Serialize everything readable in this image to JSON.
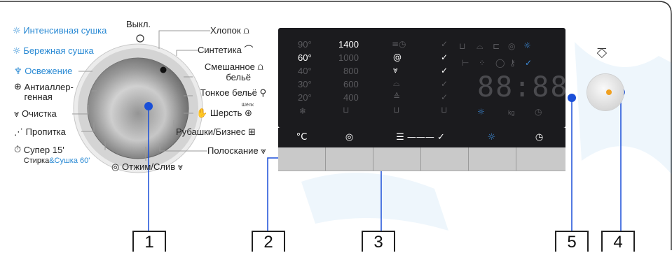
{
  "dial": {
    "off_label": "Выкл.",
    "left_programs": [
      {
        "label": "Интенсивная сушка",
        "icon": "sun-icon",
        "color": "#2a8ad4"
      },
      {
        "label": "Бережная сушка",
        "icon": "sun-icon",
        "color": "#2a8ad4"
      },
      {
        "label": "Освежение",
        "icon": "refresh-icon",
        "color": "#2a8ad4"
      },
      {
        "label": "Антиаллер-",
        "label2": "генная",
        "icon": "plus-circle-icon"
      },
      {
        "label": "Очистка",
        "icon": "drum-clean-icon"
      },
      {
        "label": "Пропитка",
        "icon": "impregnation-icon"
      },
      {
        "label": "Супер 15'",
        "sub_a": "Стирка",
        "sub_b": "&Сушка 60'",
        "icon": "timer-icon"
      }
    ],
    "right_programs": [
      {
        "label": "Хлопок",
        "icon": "cotton-icon"
      },
      {
        "label": "Синтетика",
        "icon": "synthetic-icon"
      },
      {
        "label": "Смешанное",
        "label2": "бельё",
        "icon": "mixed-icon"
      },
      {
        "label": "Тонкое бельё",
        "sub": "Шёлк",
        "icon": "delicate-icon"
      },
      {
        "label": "Шерсть",
        "icon": "wool-icon"
      },
      {
        "label": "Рубашки/Бизнес",
        "icon": "shirt-icon"
      },
      {
        "label": "Полоскание",
        "icon": "rinse-icon"
      }
    ],
    "bottom_label": "Отжим/Слив"
  },
  "display": {
    "temps": [
      "90°",
      "60°",
      "40°",
      "30°",
      "20°"
    ],
    "active_temp": "60°",
    "speeds": [
      "1400",
      "1000",
      "800",
      "600",
      "400"
    ],
    "active_speed": "1400",
    "time_digits": "88:88",
    "kg_label": "kg"
  },
  "buttons": {
    "labels": [
      "°C",
      "◎",
      "☰ ——— ✓",
      "☼",
      "◷"
    ]
  },
  "callouts": [
    "1",
    "2",
    "3",
    "5",
    "4"
  ],
  "colors": {
    "accent": "#2a8ad4",
    "marker": "#1a4fd8",
    "display_bg": "#1b1b1e"
  }
}
